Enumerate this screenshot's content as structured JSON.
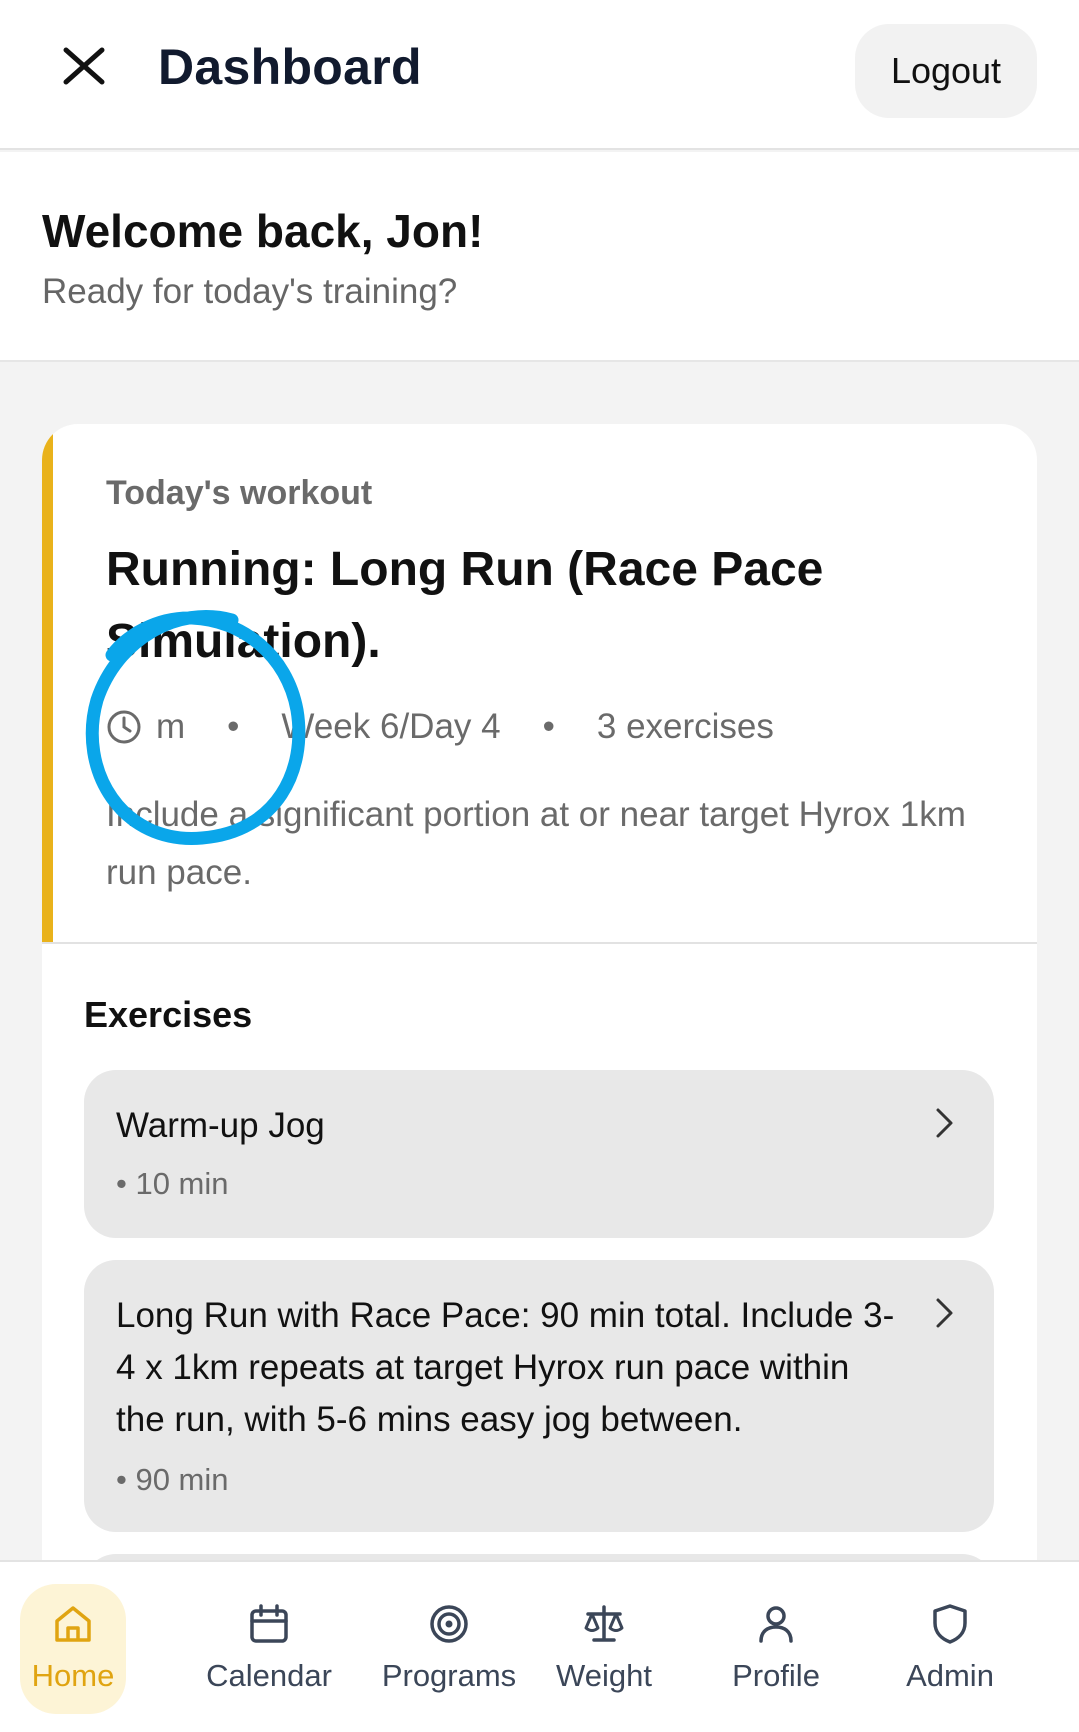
{
  "header": {
    "title": "Dashboard",
    "logout_label": "Logout"
  },
  "welcome": {
    "title": "Welcome back, Jon!",
    "subtitle": "Ready for today's training?"
  },
  "workout": {
    "label": "Today's workout",
    "title": "Running: Long Run (Race Pace Simulation).",
    "duration": "m",
    "week_day": "Week 6/Day 4",
    "separator": "•",
    "exercise_count": "3 exercises",
    "description": "Include a significant portion at or near target Hyrox 1km run pace."
  },
  "exercises": {
    "heading": "Exercises",
    "items": [
      {
        "name": "Warm-up Jog",
        "duration": "• 10 min"
      },
      {
        "name": "Long Run with Race Pace: 90 min total. Include 3-4 x 1km repeats at target Hyrox run pace within the run, with 5-6 mins easy jog between.",
        "duration": "• 90 min"
      }
    ]
  },
  "nav": {
    "items": [
      {
        "label": "Home",
        "icon": "home-icon",
        "active": true
      },
      {
        "label": "Calendar",
        "icon": "calendar-icon"
      },
      {
        "label": "Programs",
        "icon": "target-icon"
      },
      {
        "label": "Weight",
        "icon": "scale-icon"
      },
      {
        "label": "Profile",
        "icon": "user-icon"
      },
      {
        "label": "Admin",
        "icon": "shield-icon"
      }
    ]
  },
  "colors": {
    "accent": "#e9b21b",
    "active_nav_bg": "#fdf4d6",
    "active_nav_text": "#e0a411",
    "annotation": "#0aa6ea"
  }
}
